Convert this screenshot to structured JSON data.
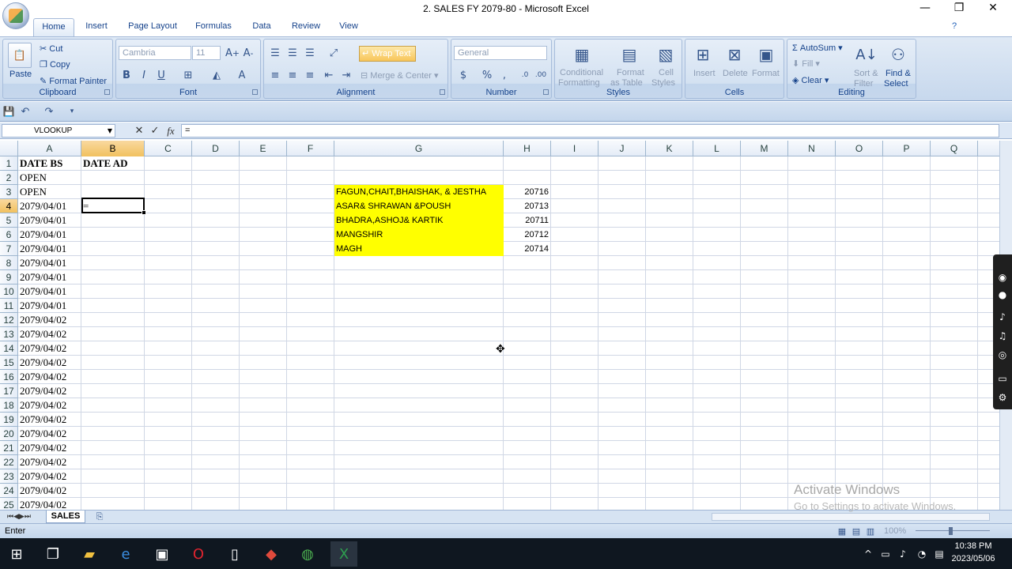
{
  "window": {
    "title": "2. SALES FY 2079-80 - Microsoft Excel",
    "minimize": "—",
    "restore": "❐",
    "close": "✕"
  },
  "tabs": [
    "Home",
    "Insert",
    "Page Layout",
    "Formulas",
    "Data",
    "Review",
    "View"
  ],
  "ribbon": {
    "clipboard": {
      "paste": "Paste",
      "cut": "Cut",
      "copy": "Copy",
      "format_painter": "Format Painter",
      "label": "Clipboard"
    },
    "font": {
      "name": "Cambria",
      "size": "11",
      "label": "Font",
      "bold": "B",
      "italic": "I",
      "underline": "U"
    },
    "alignment": {
      "wrap_text": "Wrap Text",
      "merge_center": "Merge & Center",
      "label": "Alignment"
    },
    "number": {
      "format": "General",
      "currency": "$",
      "percent": "%",
      "comma": ",",
      "label": "Number"
    },
    "styles": {
      "conditional": "Conditional",
      "conditional2": "Formatting",
      "format_as": "Format",
      "format_as2": "as Table",
      "cell_styles": "Cell",
      "cell_styles2": "Styles",
      "label": "Styles"
    },
    "cells": {
      "insert": "Insert",
      "delete": "Delete",
      "format": "Format",
      "label": "Cells"
    },
    "editing": {
      "autosum": "AutoSum",
      "fill": "Fill",
      "clear": "Clear",
      "sort": "Sort &",
      "sort2": "Filter",
      "find": "Find &",
      "find2": "Select",
      "label": "Editing"
    }
  },
  "formula_bar": {
    "name_box": "VLOOKUP",
    "fx": "fx",
    "content": "="
  },
  "columns": [
    "A",
    "B",
    "C",
    "D",
    "E",
    "F",
    "G",
    "H",
    "I",
    "J",
    "K",
    "L",
    "M",
    "N",
    "O",
    "P",
    "Q"
  ],
  "rows": [
    "1",
    "2",
    "3",
    "4",
    "5",
    "6",
    "7",
    "8",
    "9",
    "10",
    "11",
    "12",
    "13",
    "14",
    "15",
    "16",
    "17",
    "18",
    "19",
    "20",
    "21",
    "22",
    "23",
    "24",
    "25"
  ],
  "cells": {
    "A1": "DATE BS",
    "B1": "DATE AD",
    "A2": "OPEN",
    "A3": "OPEN",
    "A4": "2079/04/01",
    "A5": "2079/04/01",
    "A6": "2079/04/01",
    "A7": "2079/04/01",
    "A8": "2079/04/01",
    "A9": "2079/04/01",
    "A10": "2079/04/01",
    "A11": "2079/04/01",
    "A12": "2079/04/02",
    "A13": "2079/04/02",
    "A14": "2079/04/02",
    "A15": "2079/04/02",
    "A16": "2079/04/02",
    "A17": "2079/04/02",
    "A18": "2079/04/02",
    "A19": "2079/04/02",
    "A20": "2079/04/02",
    "A21": "2079/04/02",
    "A22": "2079/04/02",
    "A23": "2079/04/02",
    "A24": "2079/04/02",
    "A25": "2079/04/02",
    "B4": "=",
    "G3": "FAGUN,CHAIT,BHAISHAK, & JESTHA",
    "H3": "20716",
    "G4": "ASAR& SHRAWAN &POUSH",
    "H4": "20713",
    "G5": "BHADRA,ASHOJ& KARTIK",
    "H5": "20711",
    "G6": "MANGSHIR",
    "H6": "20712",
    "G7": "MAGH",
    "H7": "20714"
  },
  "highlight_color": "#ffff00",
  "sheet_tab": "SALES",
  "status": {
    "mode": "Enter",
    "zoom": "100%"
  },
  "watermark": {
    "line1": "Activate Windows",
    "line2": "Go to Settings to activate Windows."
  },
  "taskbar": {
    "time": "10:38 PM",
    "date": "2023/05/06"
  }
}
